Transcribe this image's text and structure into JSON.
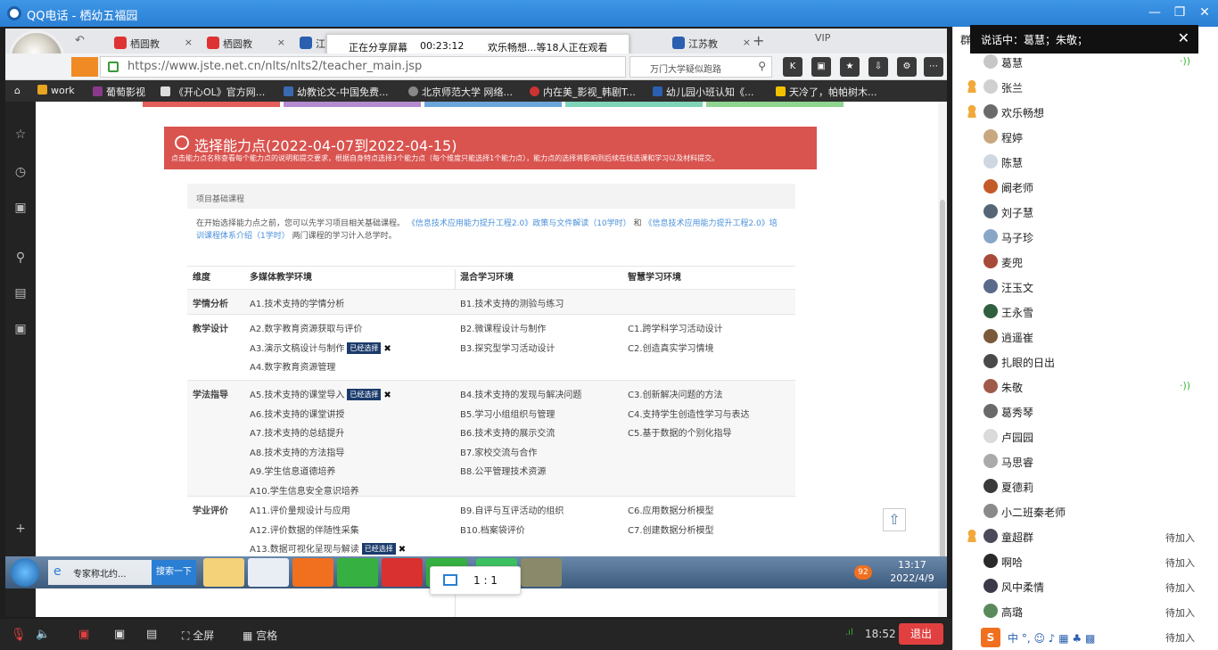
{
  "qq": {
    "title": "QQ电话 - 栖幼五福园",
    "talking_label": "说话中：葛慧；朱敬；",
    "bottom": {
      "fullscreen": "全屏",
      "grid": "宫格",
      "time": "18:52",
      "exit": "退出"
    },
    "panel_side_char": "群"
  },
  "share": {
    "status": "正在分享屏幕",
    "duration": "00:23:12",
    "viewers": "欢乐畅想...等18人正在观看"
  },
  "browser": {
    "tabs": [
      "栖圆教",
      "栖圆教",
      "江",
      "江苏教"
    ],
    "vip": "VIP",
    "url": "https://www.jste.net.cn/nlts/nlts2/teacher_main.jsp",
    "search_placeholder": "万门大学疑似跑路",
    "bookmarks": [
      "work",
      "葡萄影视",
      "《开心OL》官方网...",
      "幼教论文-中国免费...",
      "北京师范大学 网络...",
      "内在美_影视_韩剧T...",
      "幼儿园小班认知《...",
      "天冷了，帕帕树木..."
    ]
  },
  "page": {
    "banner_title": "选择能力点(2022-04-07到2022-04-15)",
    "banner_sub": "点击能力点名称查看每个能力点的说明和提交要求，根据自身特点选择3个能力点（每个维度只能选择1个能力点），能力点的选择将影响到后续在线选课和学习以及材料提交。",
    "project_head": "项目基础课程",
    "intro_a": "在开始选择能力点之前，您可以先学习项目相关基础课程。",
    "intro_link1": "《信息技术应用能力提升工程2.0》政策与文件解读（10学时）",
    "intro_and": "和",
    "intro_link2": "《信息技术应用能力提升工程2.0》培训课程体系介绍（1学时）",
    "intro_b": "两门课程的学习计入总学时。",
    "headers": [
      "维度",
      "多媒体教学环境",
      "混合学习环境",
      "智慧学习环境"
    ],
    "selected_label": "已经选择",
    "rows": [
      {
        "dim": "学情分析",
        "a": [
          "A1.技术支持的学情分析"
        ],
        "b": [
          "B1.技术支持的测验与练习"
        ],
        "c": []
      },
      {
        "dim": "教学设计",
        "a": [
          "A2.数字教育资源获取与评价",
          "A3.演示文稿设计与制作",
          "A4.数字教育资源管理"
        ],
        "b": [
          "B2.微课程设计与制作",
          "B3.探究型学习活动设计"
        ],
        "c": [
          "C1.跨学科学习活动设计",
          "C2.创造真实学习情境"
        ]
      },
      {
        "dim": "学法指导",
        "a": [
          "A5.技术支持的课堂导入",
          "A6.技术支持的课堂讲授",
          "A7.技术支持的总结提升",
          "A8.技术支持的方法指导",
          "A9.学生信息道德培养",
          "A10.学生信息安全意识培养"
        ],
        "b": [
          "B4.技术支持的发现与解决问题",
          "B5.学习小组组织与管理",
          "B6.技术支持的展示交流",
          "B7.家校交流与合作",
          "B8.公平管理技术资源"
        ],
        "c": [
          "C3.创新解决问题的方法",
          "C4.支持学生创造性学习与表达",
          "C5.基于数据的个别化指导"
        ]
      },
      {
        "dim": "学业评价",
        "a": [
          "A11.评价量规设计与应用",
          "A12.评价数据的伴随性采集",
          "A13.数据可视化呈现与解读"
        ],
        "b": [
          "B9.自评与互评活动的组织",
          "B10.档案袋评价"
        ],
        "c": [
          "C6.应用数据分析模型",
          "C7.创建数据分析模型"
        ]
      }
    ]
  },
  "taskbar": {
    "ie_label": "专家称北约...",
    "search_btn": "搜索一下",
    "clock_time": "13:17",
    "clock_date": "2022/4/9",
    "badge": "92",
    "zoom_ratio": "1 : 1"
  },
  "members": [
    {
      "name": "葛慧",
      "status": "",
      "speaking": true,
      "leader": false,
      "color": "#c7c7c7"
    },
    {
      "name": "张兰",
      "status": "",
      "speaking": false,
      "leader": true,
      "color": "#d0d0d0"
    },
    {
      "name": "欢乐畅想",
      "status": "",
      "speaking": false,
      "leader": true,
      "color": "#6b6b6b"
    },
    {
      "name": "程婷",
      "status": "",
      "speaking": false,
      "leader": false,
      "color": "#c9a77f"
    },
    {
      "name": "陈慧",
      "status": "",
      "speaking": false,
      "leader": false,
      "color": "#cfd8e0"
    },
    {
      "name": "阚老师",
      "status": "",
      "speaking": false,
      "leader": false,
      "color": "#c35a2a"
    },
    {
      "name": "刘子慧",
      "status": "",
      "speaking": false,
      "leader": false,
      "color": "#556677"
    },
    {
      "name": "马子珍",
      "status": "",
      "speaking": false,
      "leader": false,
      "color": "#8aa6c7"
    },
    {
      "name": "麦兜",
      "status": "",
      "speaking": false,
      "leader": false,
      "color": "#a84a3a"
    },
    {
      "name": "汪玉文",
      "status": "",
      "speaking": false,
      "leader": false,
      "color": "#5a6a8a"
    },
    {
      "name": "王永雪",
      "status": "",
      "speaking": false,
      "leader": false,
      "color": "#2f5f3f"
    },
    {
      "name": "逍遥崔",
      "status": "",
      "speaking": false,
      "leader": false,
      "color": "#7a5a3a"
    },
    {
      "name": "扎眼的日出",
      "status": "",
      "speaking": false,
      "leader": false,
      "color": "#4a4a4a"
    },
    {
      "name": "朱敬",
      "status": "",
      "speaking": true,
      "leader": false,
      "color": "#a05a4a"
    },
    {
      "name": "葛秀琴",
      "status": "",
      "speaking": false,
      "leader": false,
      "color": "#6a6a6a"
    },
    {
      "name": "卢园园",
      "status": "",
      "speaking": false,
      "leader": false,
      "color": "#dadada"
    },
    {
      "name": "马思睿",
      "status": "",
      "speaking": false,
      "leader": false,
      "color": "#aaaaaa"
    },
    {
      "name": "夏德莉",
      "status": "",
      "speaking": false,
      "leader": false,
      "color": "#3a3a3a"
    },
    {
      "name": "小二班秦老师",
      "status": "",
      "speaking": false,
      "leader": false,
      "color": "#8a8a8a"
    },
    {
      "name": "童超群",
      "status": "待加入",
      "speaking": false,
      "leader": true,
      "color": "#4a4a5a"
    },
    {
      "name": "啊哈",
      "status": "待加入",
      "speaking": false,
      "leader": false,
      "color": "#2a2a2a"
    },
    {
      "name": "风中柔情",
      "status": "待加入",
      "speaking": false,
      "leader": false,
      "color": "#3a3a4a"
    },
    {
      "name": "高璐",
      "status": "待加入",
      "speaking": false,
      "leader": false,
      "color": "#5a8a5a"
    },
    {
      "name": "",
      "status": "待加入",
      "speaking": false,
      "leader": false,
      "color": "#cccccc"
    }
  ],
  "colors": {
    "qq_blue": "#2a7fd4",
    "banner_red": "#d9534f",
    "selected_badge": "#1b3b6b",
    "exit_red": "#e24040",
    "speaking_green": "#3ab33a"
  }
}
